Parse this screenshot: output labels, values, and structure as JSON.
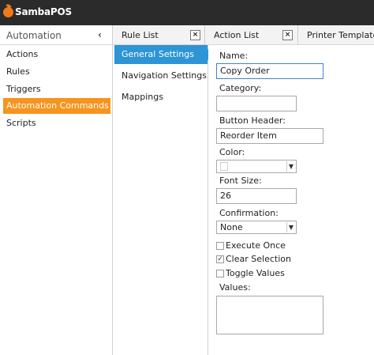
{
  "app": {
    "title": "SambaPOS"
  },
  "leftnav": {
    "header": "Automation",
    "collapse_icon": "chevron-left-icon",
    "items": [
      {
        "label": "Actions"
      },
      {
        "label": "Rules"
      },
      {
        "label": "Triggers"
      },
      {
        "label": "Automation Commands",
        "active": true
      },
      {
        "label": "Scripts"
      }
    ]
  },
  "tabs": [
    {
      "label": "Rule List",
      "close": "×"
    },
    {
      "label": "Action List",
      "close": "×"
    },
    {
      "label": "Printer Template L"
    }
  ],
  "midnav": {
    "items": [
      {
        "label": "General Settings",
        "active": true
      },
      {
        "label": "Navigation Settings"
      },
      {
        "label": "Mappings"
      }
    ]
  },
  "form": {
    "name_label": "Name:",
    "name_value": "Copy Order",
    "category_label": "Category:",
    "category_value": "",
    "button_header_label": "Button Header:",
    "button_header_value": "Reorder Item",
    "color_label": "Color:",
    "font_size_label": "Font Size:",
    "font_size_value": "26",
    "confirmation_label": "Confirmation:",
    "confirmation_value": "None",
    "combo_arrow": "▼",
    "execute_once_label": "Execute Once",
    "execute_once_checked": false,
    "clear_selection_label": "Clear Selection",
    "clear_selection_checked": true,
    "toggle_values_label": "Toggle Values",
    "toggle_values_checked": false,
    "check_mark": "✓",
    "values_label": "Values:",
    "values_value": ""
  },
  "colors": {
    "titlebar": "#2b2b2b",
    "accent_orange": "#f7941e",
    "accent_blue": "#2d94d6"
  }
}
